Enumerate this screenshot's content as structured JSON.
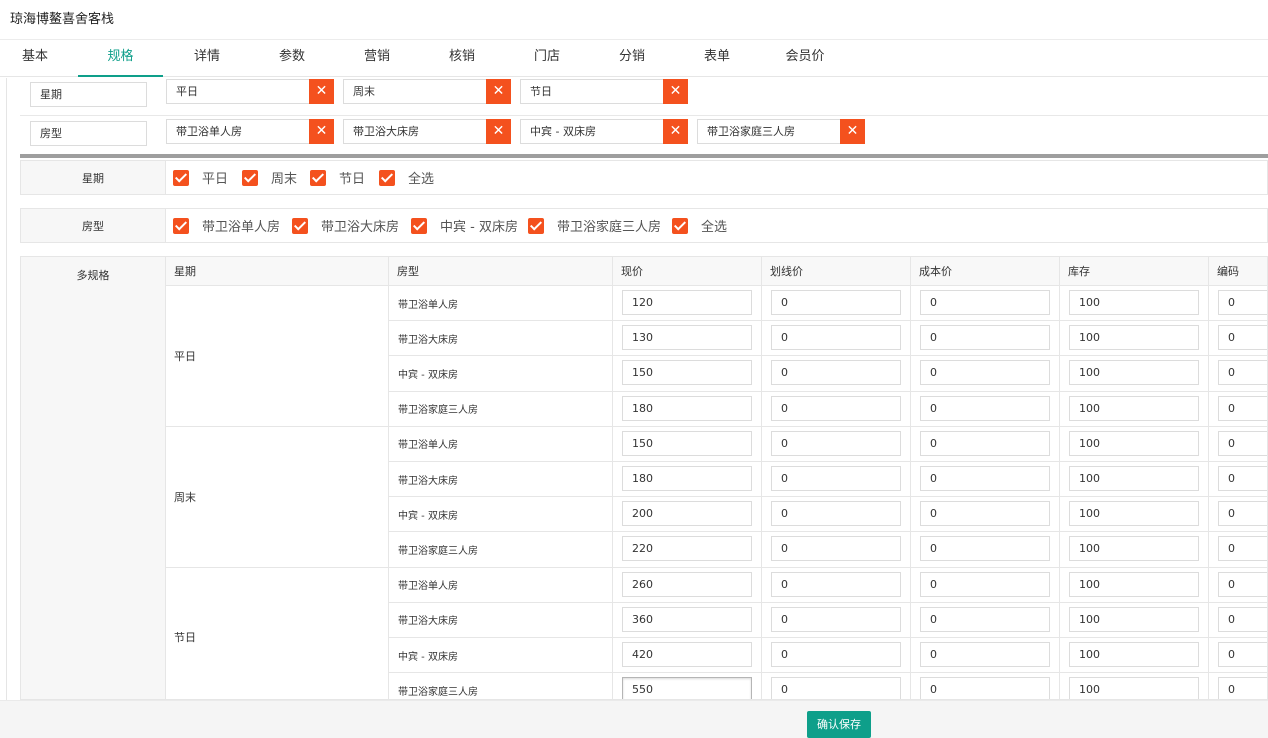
{
  "app": {
    "title": "琼海博鳌喜舍客栈"
  },
  "tabs": [
    {
      "label": "基本",
      "active": false
    },
    {
      "label": "规格",
      "active": true
    },
    {
      "label": "详情",
      "active": false
    },
    {
      "label": "参数",
      "active": false
    },
    {
      "label": "营销",
      "active": false
    },
    {
      "label": "核销",
      "active": false
    },
    {
      "label": "门店",
      "active": false
    },
    {
      "label": "分销",
      "active": false
    },
    {
      "label": "表单",
      "active": false
    },
    {
      "label": "会员价",
      "active": false
    }
  ],
  "spec_groups": [
    {
      "name": "星期",
      "values": [
        "平日",
        "周末",
        "节日"
      ]
    },
    {
      "name": "房型",
      "values": [
        "带卫浴单人房",
        "带卫浴大床房",
        "中宾 - 双床房",
        "带卫浴家庭三人房"
      ]
    }
  ],
  "delete_symbol": "✕",
  "selectors": [
    {
      "label": "星期",
      "options": [
        "平日",
        "周末",
        "节日",
        "全选"
      ]
    },
    {
      "label": "房型",
      "options": [
        "带卫浴单人房",
        "带卫浴大床房",
        "中宾 - 双床房",
        "带卫浴家庭三人房",
        "全选"
      ]
    }
  ],
  "multi_spec": {
    "label": "多规格",
    "headers": [
      "星期",
      "房型",
      "现价",
      "划线价",
      "成本价",
      "库存",
      "编码"
    ],
    "groups": [
      {
        "week": "平日",
        "rows": [
          {
            "room": "带卫浴单人房",
            "price": "120",
            "line_price": "0",
            "cost": "0",
            "stock": "100",
            "code": "0"
          },
          {
            "room": "带卫浴大床房",
            "price": "130",
            "line_price": "0",
            "cost": "0",
            "stock": "100",
            "code": "0"
          },
          {
            "room": "中宾 - 双床房",
            "price": "150",
            "line_price": "0",
            "cost": "0",
            "stock": "100",
            "code": "0"
          },
          {
            "room": "带卫浴家庭三人房",
            "price": "180",
            "line_price": "0",
            "cost": "0",
            "stock": "100",
            "code": "0"
          }
        ]
      },
      {
        "week": "周末",
        "rows": [
          {
            "room": "带卫浴单人房",
            "price": "150",
            "line_price": "0",
            "cost": "0",
            "stock": "100",
            "code": "0"
          },
          {
            "room": "带卫浴大床房",
            "price": "180",
            "line_price": "0",
            "cost": "0",
            "stock": "100",
            "code": "0"
          },
          {
            "room": "中宾 - 双床房",
            "price": "200",
            "line_price": "0",
            "cost": "0",
            "stock": "100",
            "code": "0"
          },
          {
            "room": "带卫浴家庭三人房",
            "price": "220",
            "line_price": "0",
            "cost": "0",
            "stock": "100",
            "code": "0"
          }
        ]
      },
      {
        "week": "节日",
        "rows": [
          {
            "room": "带卫浴单人房",
            "price": "260",
            "line_price": "0",
            "cost": "0",
            "stock": "100",
            "code": "0"
          },
          {
            "room": "带卫浴大床房",
            "price": "360",
            "line_price": "0",
            "cost": "0",
            "stock": "100",
            "code": "0"
          },
          {
            "room": "中宾 - 双床房",
            "price": "420",
            "line_price": "0",
            "cost": "0",
            "stock": "100",
            "code": "0"
          },
          {
            "room": "带卫浴家庭三人房",
            "price": "550",
            "line_price": "0",
            "cost": "0",
            "stock": "100",
            "code": "0"
          }
        ]
      }
    ]
  },
  "footer": {
    "save_label": "确认保存"
  },
  "colors": {
    "accent": "#0e9f8a",
    "danger": "#f4511e"
  }
}
